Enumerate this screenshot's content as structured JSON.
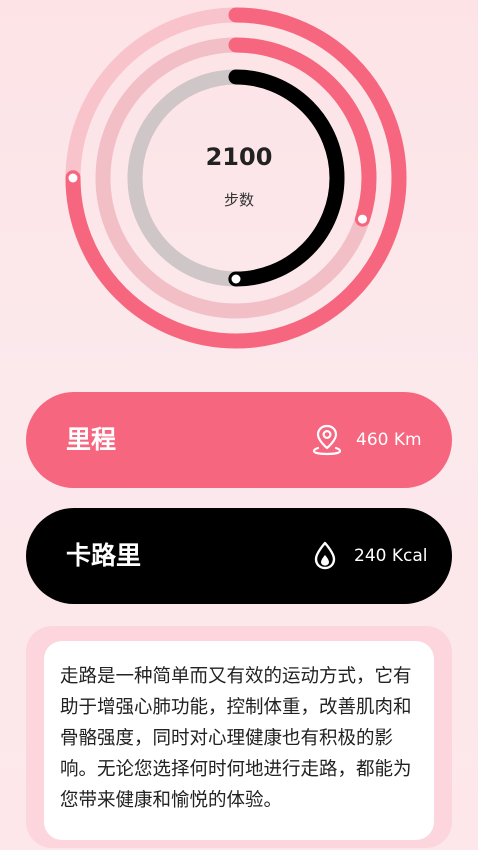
{
  "activity": {
    "steps_value": "2100",
    "steps_label": "步数",
    "rings": {
      "outer_progress": 0.75,
      "middle_progress": 0.3,
      "inner_progress": 0.5
    }
  },
  "stats": [
    {
      "label": "里程",
      "value": "460 Km",
      "icon": "location-pin-icon"
    },
    {
      "label": "卡路里",
      "value": "240 Kcal",
      "icon": "flame-drop-icon"
    }
  ],
  "info": {
    "text": "走路是一种简单而又有效的运动方式，它有助于增强心肺功能，控制体重，改善肌肉和骨骼强度，同时对心理健康也有积极的影响。无论您选择何时何地进行走路，都能为您带来健康和愉悦的体验。"
  },
  "colors": {
    "accent": "#f6667f",
    "track_outer": "#f9c3cb",
    "track_middle": "#f2bfc7",
    "track_inner": "#cfc6c8",
    "dark": "#000000"
  }
}
